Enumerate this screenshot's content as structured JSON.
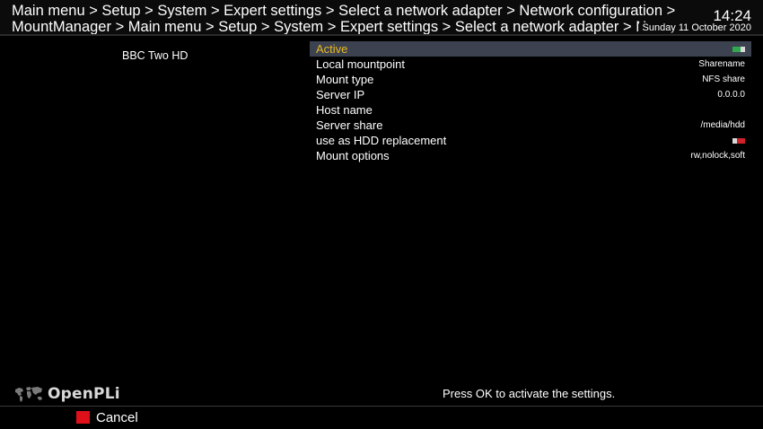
{
  "header": {
    "breadcrumb_line1": "Main menu > Setup > System > Expert settings > Select a network adapter > Network configuration >",
    "breadcrumb_line2": "MountManager > Main menu > Setup > System > Expert settings > Select a network adapter > Network",
    "time": "14:24",
    "date": "Sunday 11 October 2020"
  },
  "preview": {
    "channel_name": "BBC Two HD"
  },
  "config": {
    "items": [
      {
        "label": "Active",
        "type": "toggle",
        "state": "on",
        "selected": true
      },
      {
        "label": "Local mountpoint",
        "value": "Sharename"
      },
      {
        "label": "Mount type",
        "value": "NFS share"
      },
      {
        "label": "Server IP",
        "value": "0.0.0.0"
      },
      {
        "label": "Host name",
        "value": ""
      },
      {
        "label": "Server share",
        "value": "/media/hdd"
      },
      {
        "label": "use as HDD replacement",
        "type": "toggle",
        "state": "off"
      },
      {
        "label": "Mount options",
        "value": "rw,nolock,soft"
      }
    ]
  },
  "footer": {
    "logo_text": "OpenPLi",
    "hint": "Press OK to activate the settings.",
    "cancel_label": "Cancel",
    "cancel_key_icon": "red-button-icon"
  },
  "colors": {
    "background": "#000000",
    "header_bg": "#0b0b0b",
    "selection_bg": "#3c4250",
    "selected_text": "#e8b923",
    "toggle_on": "#2fa84f",
    "toggle_off": "#d0202a",
    "toggle_knob": "#d8d8d8",
    "red_key": "#e0101a"
  }
}
